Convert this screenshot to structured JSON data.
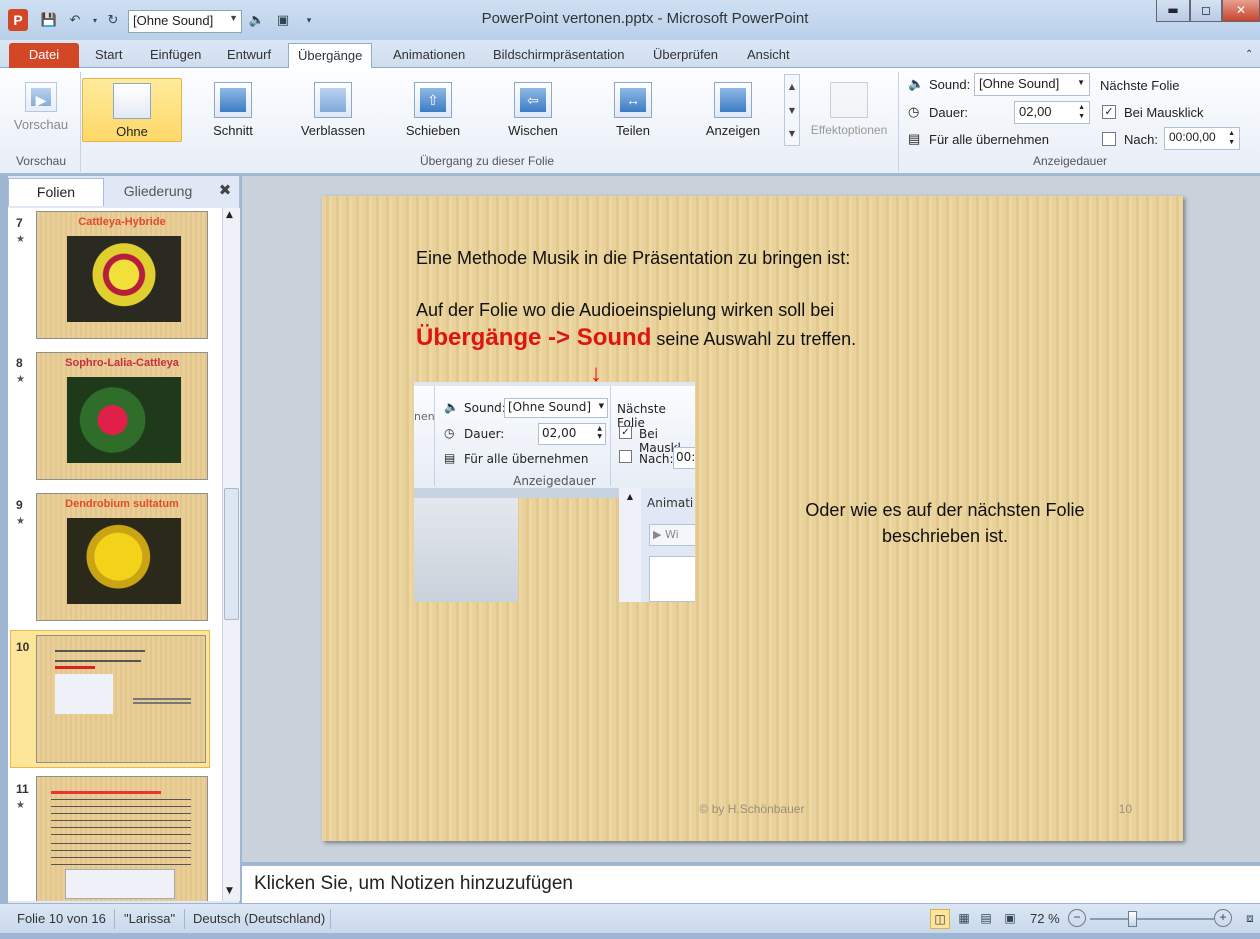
{
  "window": {
    "title": "PowerPoint vertonen.pptx - Microsoft PowerPoint"
  },
  "qat": {
    "sound_value": "[Ohne Sound]"
  },
  "tabs": [
    "Datei",
    "Start",
    "Einfügen",
    "Entwurf",
    "Übergänge",
    "Animationen",
    "Bildschirmpräsentation",
    "Überprüfen",
    "Ansicht"
  ],
  "ribbon": {
    "preview_label": "Vorschau",
    "preview_group": "Vorschau",
    "transitions": [
      "Ohne",
      "Schnitt",
      "Verblassen",
      "Schieben",
      "Wischen",
      "Teilen",
      "Anzeigen"
    ],
    "effect_options": "Effektoptionen",
    "transition_group": "Übergang zu dieser Folie",
    "sound_label": "Sound:",
    "sound_value": "[Ohne Sound]",
    "duration_label": "Dauer:",
    "duration_value": "02,00",
    "apply_all": "Für alle übernehmen",
    "next_slide_label": "Nächste Folie",
    "on_click_label": "Bei Mausklick",
    "on_click_checked": true,
    "after_label": "Nach:",
    "after_value": "00:00,00",
    "timing_group": "Anzeigedauer"
  },
  "pane": {
    "tab_slides": "Folien",
    "tab_outline": "Gliederung",
    "thumbs": [
      {
        "num": "7",
        "title": "Cattleya-Hybride"
      },
      {
        "num": "8",
        "title": "Sophro-Lalia-Cattleya"
      },
      {
        "num": "9",
        "title": "Dendrobium sultatum"
      },
      {
        "num": "10",
        "title": ""
      },
      {
        "num": "11",
        "title": ""
      }
    ]
  },
  "slide": {
    "line1": "Eine Methode Musik in die Präsentation zu bringen ist:",
    "line2": "Auf der Folie wo die Audioeinspielung wirken soll bei",
    "highlight": "Übergänge -> Sound",
    "line3_rest": " seine Auswahl zu treffen.",
    "right_text_1": "Oder wie es auf der nächsten Folie",
    "right_text_2": "beschrieben ist.",
    "footer": "© by H.Schönbauer",
    "page_number": "10",
    "inset": {
      "sound_label": "Sound:",
      "sound_value": "[Ohne Sound]",
      "next_slide": "Nächste Folie",
      "duration_label": "Dauer:",
      "duration_value": "02,00",
      "on_click": "Bei Mauskl",
      "apply_all": "Für alle übernehmen",
      "after_label": "Nach:",
      "after_value": "00:0",
      "group": "Anzeigedauer",
      "left_cut": "nen",
      "anim": "Animati",
      "wi": "Wi"
    }
  },
  "notes": {
    "placeholder": "Klicken Sie, um Notizen hinzuzufügen"
  },
  "status": {
    "slide_info": "Folie 10 von 16",
    "theme": "\"Larissa\"",
    "language": "Deutsch (Deutschland)",
    "zoom": "72 %"
  }
}
